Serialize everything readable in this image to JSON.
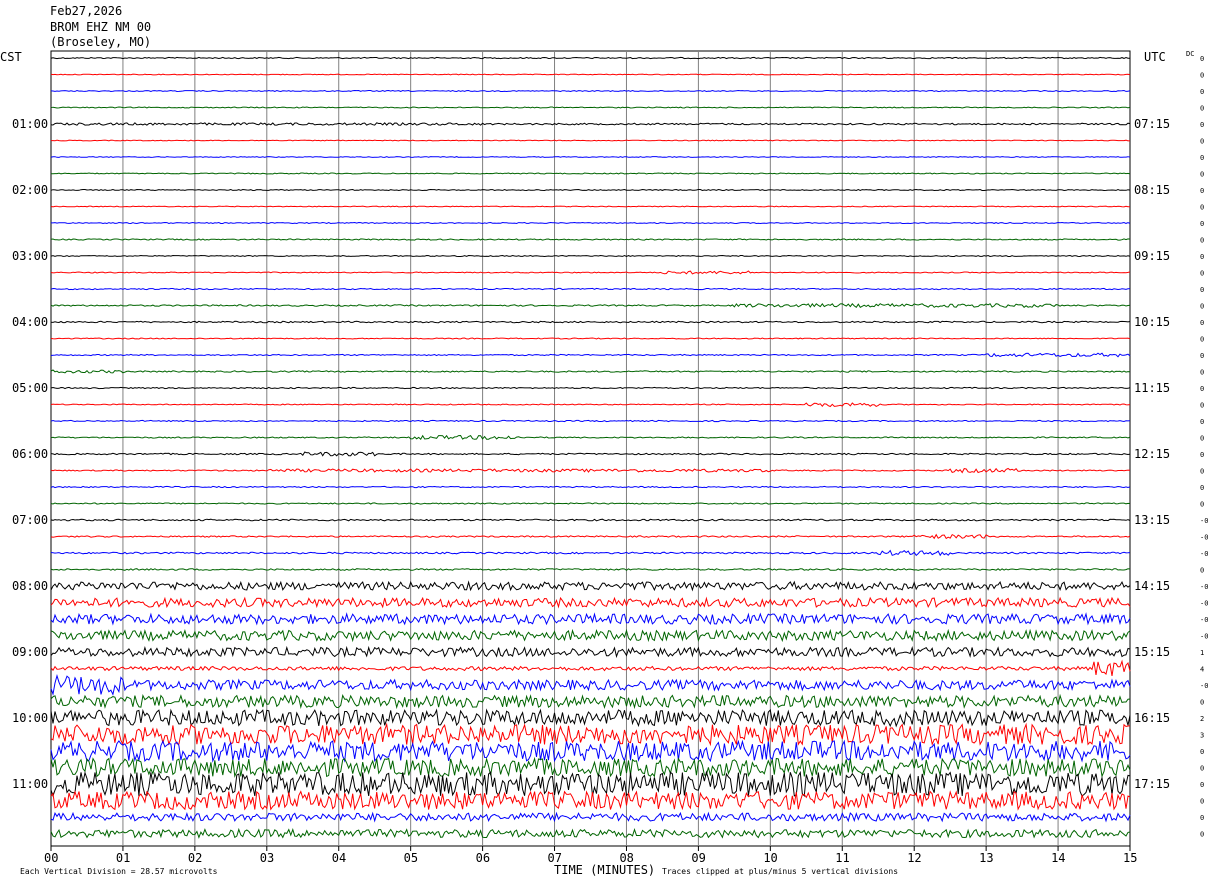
{
  "header": {
    "date": "Feb27,2026",
    "station": "BROM EHZ NM 00",
    "location": "(Broseley, MO)"
  },
  "left_zone": "CST",
  "right_zone": "UTC",
  "dc_label": "DC",
  "footer": {
    "xlabel": "TIME (MINUTES)",
    "scale_note": "Each Vertical Division =   28.57 microvolts",
    "clip_note": "Traces clipped at plus/minus 5 vertical divisions"
  },
  "colors": {
    "black": "#000000",
    "red": "#ff0000",
    "blue": "#0000ff",
    "green": "#006400",
    "grid": "#808080"
  },
  "chart_data": {
    "type": "line",
    "title": "",
    "xlabel": "TIME (MINUTES)",
    "ylabel": "",
    "xlim": [
      0,
      15
    ],
    "x_ticks": [
      "00",
      "01",
      "02",
      "03",
      "04",
      "05",
      "06",
      "07",
      "08",
      "09",
      "10",
      "11",
      "12",
      "13",
      "14",
      "15"
    ],
    "trace_minutes": 15,
    "trace_color_cycle": [
      "black",
      "red",
      "blue",
      "green"
    ],
    "left_time_labels": [
      {
        "row": 4,
        "label": "01:00"
      },
      {
        "row": 8,
        "label": "02:00"
      },
      {
        "row": 12,
        "label": "03:00"
      },
      {
        "row": 16,
        "label": "04:00"
      },
      {
        "row": 20,
        "label": "05:00"
      },
      {
        "row": 24,
        "label": "06:00"
      },
      {
        "row": 28,
        "label": "07:00"
      },
      {
        "row": 32,
        "label": "08:00"
      },
      {
        "row": 36,
        "label": "09:00"
      },
      {
        "row": 40,
        "label": "10:00"
      },
      {
        "row": 44,
        "label": "11:00"
      }
    ],
    "right_time_labels": [
      {
        "row": 4,
        "label": "07:15"
      },
      {
        "row": 8,
        "label": "08:15"
      },
      {
        "row": 12,
        "label": "09:15"
      },
      {
        "row": 16,
        "label": "10:15"
      },
      {
        "row": 20,
        "label": "11:15"
      },
      {
        "row": 24,
        "label": "12:15"
      },
      {
        "row": 28,
        "label": "13:15"
      },
      {
        "row": 32,
        "label": "14:15"
      },
      {
        "row": 36,
        "label": "15:15"
      },
      {
        "row": 40,
        "label": "16:15"
      },
      {
        "row": 44,
        "label": "17:15"
      }
    ],
    "dc_offsets": [
      "0",
      "0",
      "0",
      "0",
      "0",
      "0",
      "0",
      "0",
      "0",
      "0",
      "0",
      "0",
      "0",
      "0",
      "0",
      "0",
      "0",
      "0",
      "0",
      "0",
      "0",
      "0",
      "0",
      "0",
      "0",
      "0",
      "0",
      "0",
      "-0",
      "-0",
      "-0",
      "0",
      "-0",
      "-0",
      "-0",
      "-0",
      "1",
      "4",
      "-0",
      "0",
      "2",
      "3",
      "0",
      "0",
      "0",
      "0",
      "0",
      "0"
    ],
    "traces": [
      {
        "row": 0,
        "amp": 0.6
      },
      {
        "row": 1,
        "amp": 0.4
      },
      {
        "row": 2,
        "amp": 0.5
      },
      {
        "row": 3,
        "amp": 0.5
      },
      {
        "row": 4,
        "amp": 0.8,
        "bursts": [
          [
            0,
            6,
            1.2
          ]
        ]
      },
      {
        "row": 5,
        "amp": 0.4
      },
      {
        "row": 6,
        "amp": 0.4
      },
      {
        "row": 7,
        "amp": 0.5
      },
      {
        "row": 8,
        "amp": 0.5
      },
      {
        "row": 9,
        "amp": 0.4
      },
      {
        "row": 10,
        "amp": 0.5
      },
      {
        "row": 11,
        "amp": 0.6
      },
      {
        "row": 12,
        "amp": 0.5
      },
      {
        "row": 13,
        "amp": 0.5,
        "bursts": [
          [
            8.5,
            9.8,
            1.5
          ]
        ]
      },
      {
        "row": 14,
        "amp": 0.6
      },
      {
        "row": 15,
        "amp": 0.7,
        "bursts": [
          [
            9.5,
            14,
            1.8
          ]
        ]
      },
      {
        "row": 16,
        "amp": 0.7
      },
      {
        "row": 17,
        "amp": 0.5
      },
      {
        "row": 18,
        "amp": 0.6,
        "bursts": [
          [
            13,
            15,
            1.8
          ]
        ]
      },
      {
        "row": 19,
        "amp": 0.7,
        "bursts": [
          [
            0,
            1,
            1.5
          ]
        ]
      },
      {
        "row": 20,
        "amp": 0.6
      },
      {
        "row": 21,
        "amp": 0.5,
        "bursts": [
          [
            10.5,
            11.5,
            2
          ]
        ]
      },
      {
        "row": 22,
        "amp": 0.6
      },
      {
        "row": 23,
        "amp": 0.6,
        "bursts": [
          [
            5,
            6.5,
            2
          ]
        ]
      },
      {
        "row": 24,
        "amp": 0.7,
        "bursts": [
          [
            3.5,
            4.5,
            2
          ]
        ]
      },
      {
        "row": 25,
        "amp": 0.6,
        "bursts": [
          [
            3,
            10,
            1.5
          ],
          [
            12.5,
            13.5,
            2
          ]
        ]
      },
      {
        "row": 26,
        "amp": 0.6
      },
      {
        "row": 27,
        "amp": 0.6
      },
      {
        "row": 28,
        "amp": 0.8
      },
      {
        "row": 29,
        "amp": 0.7,
        "bursts": [
          [
            12,
            13,
            2
          ]
        ]
      },
      {
        "row": 30,
        "amp": 0.8,
        "bursts": [
          [
            11.5,
            12.5,
            2.5
          ]
        ]
      },
      {
        "row": 31,
        "amp": 0.8
      },
      {
        "row": 32,
        "amp": 4
      },
      {
        "row": 33,
        "amp": 4.5
      },
      {
        "row": 34,
        "amp": 5
      },
      {
        "row": 35,
        "amp": 5
      },
      {
        "row": 36,
        "amp": 4.5
      },
      {
        "row": 37,
        "amp": 2,
        "bursts": [
          [
            14.5,
            15,
            8
          ]
        ]
      },
      {
        "row": 38,
        "amp": 5,
        "bursts": [
          [
            0,
            1,
            10
          ]
        ]
      },
      {
        "row": 39,
        "amp": 6
      },
      {
        "row": 40,
        "amp": 8
      },
      {
        "row": 41,
        "amp": 10
      },
      {
        "row": 42,
        "amp": 10
      },
      {
        "row": 43,
        "amp": 9
      },
      {
        "row": 44,
        "amp": 12
      },
      {
        "row": 45,
        "amp": 9
      },
      {
        "row": 46,
        "amp": 4
      },
      {
        "row": 47,
        "amp": 4
      }
    ]
  }
}
